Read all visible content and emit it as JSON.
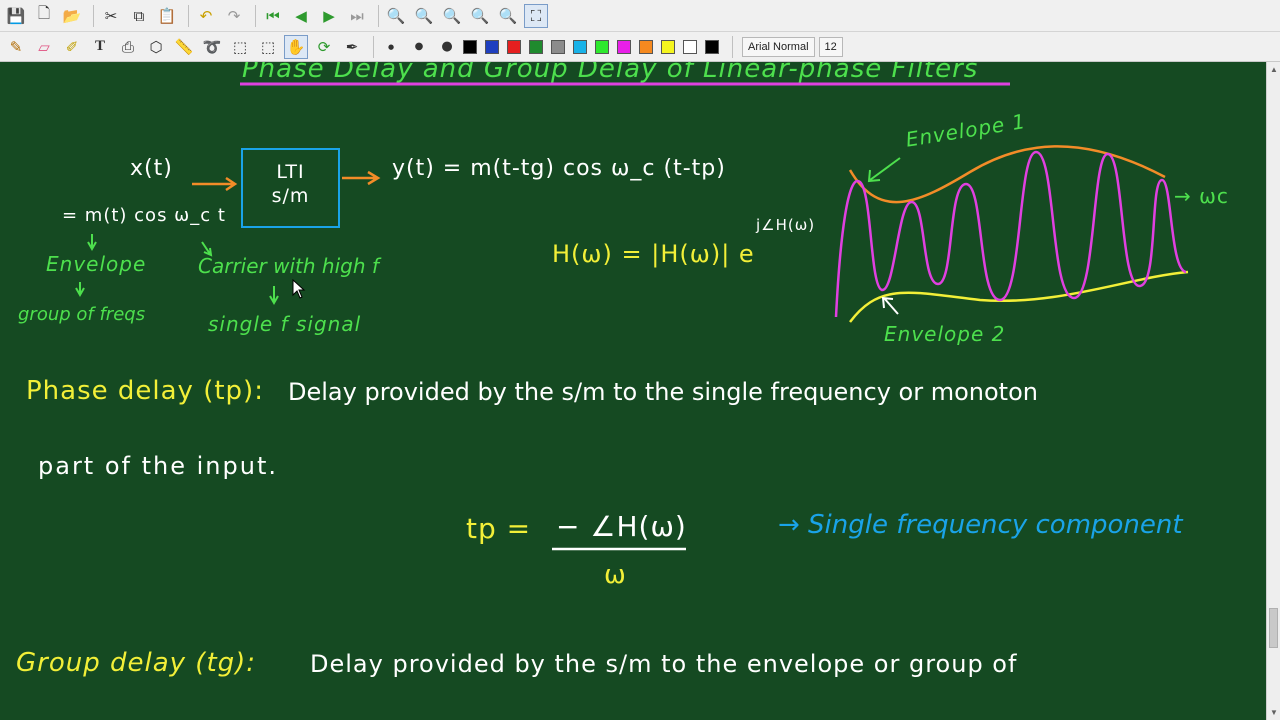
{
  "toolbar_font": {
    "name": "Arial Normal",
    "size": "12"
  },
  "palette": [
    "#000000",
    "#1f3fbf",
    "#e51f1f",
    "#1f8a2e",
    "#8c8c8c",
    "#19b2e8",
    "#2ee82e",
    "#e81fe8",
    "#f5891f",
    "#f5f51f",
    "#ffffff",
    "#000000"
  ],
  "board": {
    "title": "Phase Delay and Group Delay of Linear-phase Filters",
    "input_label": "x(t)",
    "input_expr": "= m(t) cos ω_c t",
    "lti_label": "LTI\ns/m",
    "output_expr": "y(t) = m(t-tg) cos ω_c (t-tp)",
    "envelope_note": "Envelope",
    "group_note": "group of freqs",
    "carrier_note": "Carrier with high f",
    "single_note": "single f signal",
    "h_expr": "H(ω) = |H(ω)| e",
    "h_exponent": "j∠H(ω)",
    "env1_label": "Envelope 1",
    "env2_label": "Envelope 2",
    "wc_label": "→ ωc",
    "phase_heading": "Phase delay (tp):",
    "phase_text1": "Delay provided by the s/m to the single frequency or monoton",
    "phase_text2": "part of the input.",
    "tp_lhs": "tp =",
    "tp_num": "− ∠H(ω)",
    "tp_den": "ω",
    "single_comp": "→ Single frequency component",
    "group_heading": "Group delay (tg):",
    "group_text": "Delay provided by the s/m to the envelope or group of"
  }
}
